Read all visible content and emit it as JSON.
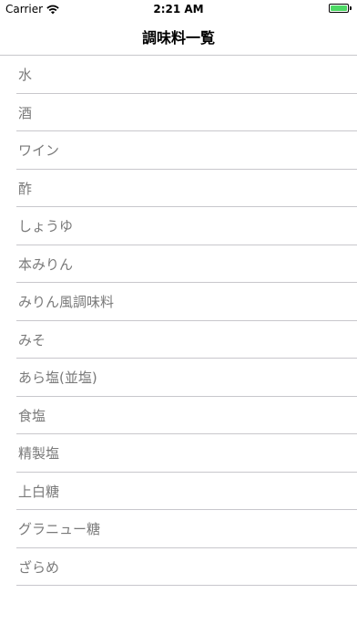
{
  "status_bar": {
    "carrier": "Carrier",
    "time": "2:21 AM",
    "battery_level": 1.0,
    "battery_color": "#4cd964"
  },
  "nav": {
    "title": "調味料一覧"
  },
  "items": [
    "水",
    "酒",
    "ワイン",
    "酢",
    "しょうゆ",
    "本みりん",
    "みりん風調味料",
    "みそ",
    "あら塩(並塩)",
    "食塩",
    "精製塩",
    "上白糖",
    "グラニュー糖",
    "ざらめ"
  ]
}
